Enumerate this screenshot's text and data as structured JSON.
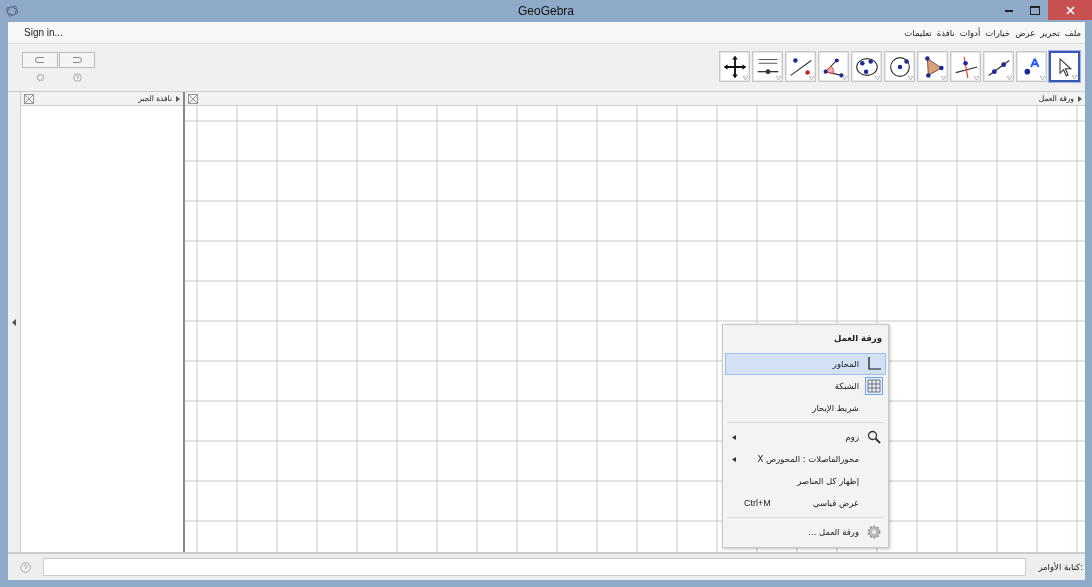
{
  "window": {
    "title": "GeoGebra"
  },
  "sign_in": "Sign in...",
  "menu": [
    {
      "label": "ملف"
    },
    {
      "label": "تحرير"
    },
    {
      "label": "عرض"
    },
    {
      "label": "خيارات"
    },
    {
      "label": "أدوات"
    },
    {
      "label": "نافذة"
    },
    {
      "label": "تعليمات"
    }
  ],
  "toolbar": {
    "tools": [
      {
        "kind": "pointer",
        "selected": true
      },
      {
        "kind": "point",
        "selected": false
      },
      {
        "kind": "line",
        "selected": false
      },
      {
        "kind": "perpendicular",
        "selected": false
      },
      {
        "kind": "polygon",
        "selected": false
      },
      {
        "kind": "circle",
        "selected": false
      },
      {
        "kind": "conic",
        "selected": false
      },
      {
        "kind": "angle",
        "selected": false
      },
      {
        "kind": "reflect",
        "selected": false
      },
      {
        "kind": "slider",
        "selected": false
      },
      {
        "kind": "move-view",
        "selected": false
      }
    ]
  },
  "algebra_view": {
    "title": "نافذة الجبر"
  },
  "graphics_view": {
    "title": "ورقة العمل"
  },
  "context_menu": {
    "title": "ورقة العمل",
    "items": [
      {
        "kind": "axes",
        "label": "المحاور",
        "checked": false,
        "selected": true
      },
      {
        "kind": "grid",
        "label": "الشبكة",
        "checked": true,
        "selected": false
      },
      {
        "kind": "item",
        "label": "شريط الإبحار",
        "checked": false,
        "selected": false
      },
      {
        "kind": "separator"
      },
      {
        "kind": "zoom",
        "label": "زوم",
        "submenu": true,
        "checked": false,
        "selected": false
      },
      {
        "kind": "item",
        "label": "محورالفاصلات : المحورص X",
        "submenu": true,
        "checked": false,
        "selected": false
      },
      {
        "kind": "item",
        "label": "إظهار كل العناصر",
        "checked": false,
        "selected": false
      },
      {
        "kind": "item",
        "label": "عرض قياسي",
        "shortcut": "Ctrl+M",
        "checked": false,
        "selected": false
      },
      {
        "kind": "separator"
      },
      {
        "kind": "gear",
        "label": "ورقة العمل ...",
        "checked": false,
        "selected": false
      }
    ]
  },
  "input_bar": {
    "label": "كتابة الأوامر:"
  }
}
